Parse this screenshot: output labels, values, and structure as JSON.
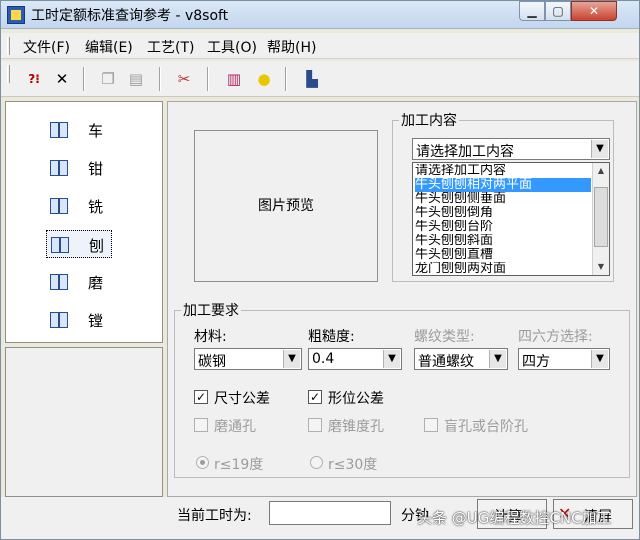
{
  "window": {
    "title": "工时定额标准查询参考 - v8soft"
  },
  "menu": [
    {
      "label": "文件(F)"
    },
    {
      "label": "编辑(E)"
    },
    {
      "label": "工艺(T)"
    },
    {
      "label": "工具(O)"
    },
    {
      "label": "帮助(H)"
    }
  ],
  "toolbar": {
    "buttons": [
      {
        "icon": "help-pointer-icon",
        "glyph": "?⁝"
      },
      {
        "icon": "close-x-icon",
        "glyph": "✕"
      },
      {
        "icon": "copy-icon",
        "glyph": "❐"
      },
      {
        "icon": "paste-icon",
        "glyph": "▤"
      },
      {
        "icon": "tools-icon",
        "glyph": "✂"
      },
      {
        "icon": "books-icon",
        "glyph": "▥"
      },
      {
        "icon": "lightbulb-icon",
        "glyph": "●"
      },
      {
        "icon": "exit-door-icon",
        "glyph": "▙"
      }
    ]
  },
  "nav": {
    "items": [
      {
        "label": "车",
        "selected": false
      },
      {
        "label": "钳",
        "selected": false
      },
      {
        "label": "铣",
        "selected": false
      },
      {
        "label": "刨",
        "selected": true
      },
      {
        "label": "磨",
        "selected": false
      },
      {
        "label": "镗",
        "selected": false
      }
    ]
  },
  "preview": {
    "label": "图片预览"
  },
  "content": {
    "legend": "加工内容",
    "selected_value": "请选择加工内容",
    "options": [
      {
        "label": "请选择加工内容",
        "selected": false
      },
      {
        "label": "牛头刨刨相对两平面",
        "selected": true
      },
      {
        "label": "牛头刨刨侧垂面",
        "selected": false
      },
      {
        "label": "牛头刨刨倒角",
        "selected": false
      },
      {
        "label": "牛头刨刨台阶",
        "selected": false
      },
      {
        "label": "牛头刨刨斜面",
        "selected": false
      },
      {
        "label": "牛头刨刨直槽",
        "selected": false
      },
      {
        "label": "龙门刨刨两对面",
        "selected": false
      }
    ]
  },
  "requirements": {
    "legend": "加工要求",
    "material": {
      "label": "材料:",
      "value": "碳钢"
    },
    "roughness": {
      "label": "粗糙度:",
      "value": "0.4"
    },
    "thread_type": {
      "label": "螺纹类型:",
      "value": "普通螺纹"
    },
    "hex_select": {
      "label": "四六方选择:",
      "value": "四方"
    },
    "checks": [
      {
        "label": "尺寸公差",
        "checked": true,
        "enabled": true
      },
      {
        "label": "形位公差",
        "checked": true,
        "enabled": true
      },
      {
        "label": "磨通孔",
        "checked": false,
        "enabled": false
      },
      {
        "label": "磨锥度孔",
        "checked": false,
        "enabled": false
      },
      {
        "label": "盲孔或台阶孔",
        "checked": false,
        "enabled": false
      }
    ],
    "radios": [
      {
        "label": "r≤19度",
        "selected": true
      },
      {
        "label": "r≤30度",
        "selected": false
      }
    ]
  },
  "status": {
    "current_label": "当前工时为:",
    "current_value": "",
    "unit": "分钟",
    "calc_button": "计算",
    "clear_button": "清屏"
  },
  "watermark": "头条 @UG编程数控CNC加工"
}
